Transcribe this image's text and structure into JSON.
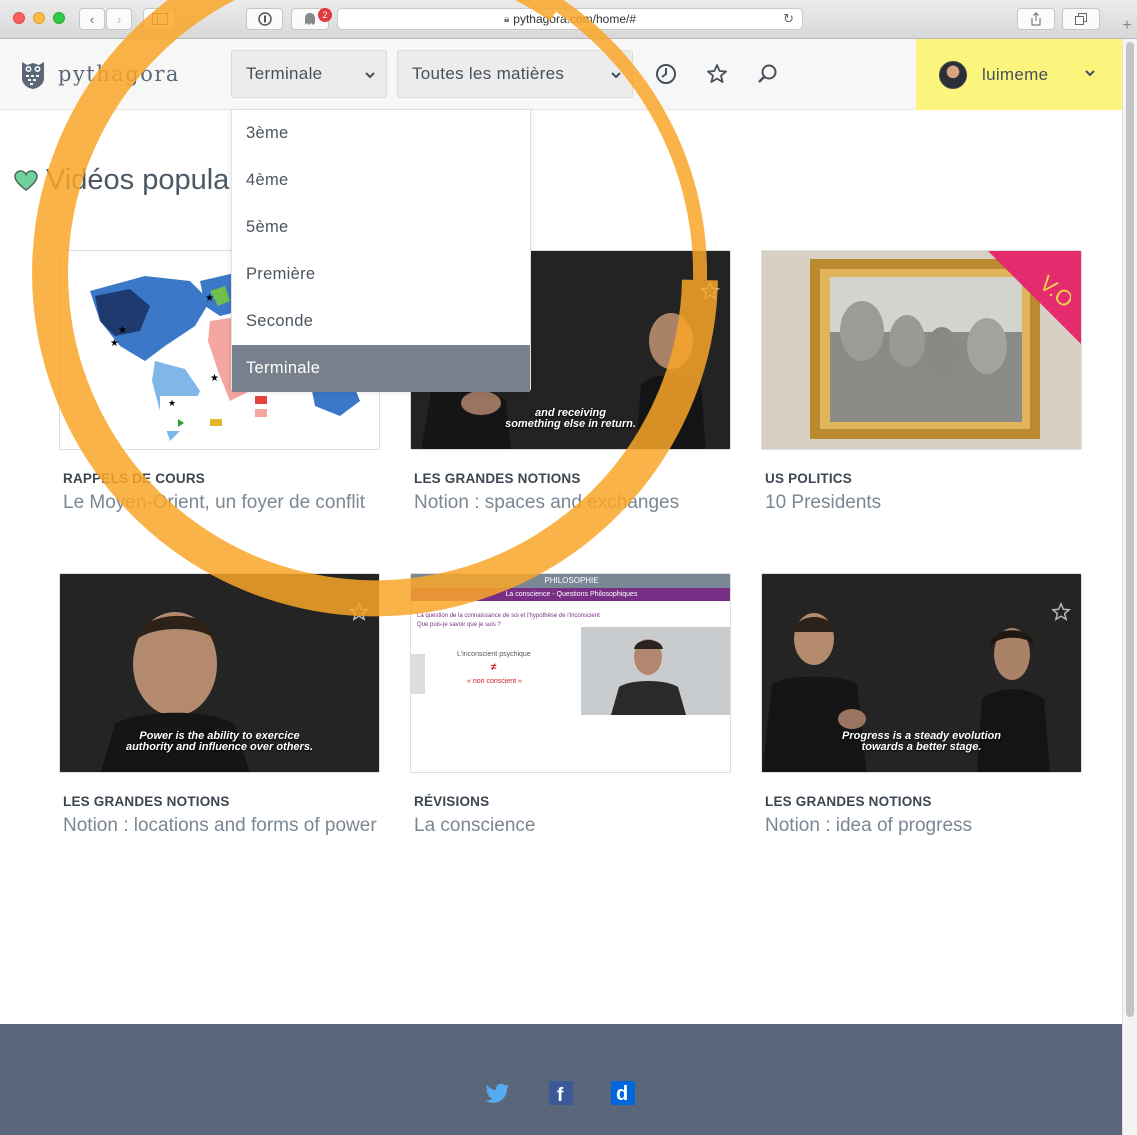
{
  "browser": {
    "url": "pythagora.com/home/#",
    "notification_count": "2"
  },
  "header": {
    "logo_text": "pythagora",
    "level_select": "Terminale",
    "subject_select": "Toutes les matières",
    "icons": [
      "history-icon",
      "star-icon",
      "search-icon"
    ],
    "username": "luimeme",
    "user_area_color": "#fbf57d"
  },
  "dropdown": {
    "items": [
      {
        "label": "3ème",
        "selected": false
      },
      {
        "label": "4ème",
        "selected": false
      },
      {
        "label": "5ème",
        "selected": false
      },
      {
        "label": "Première",
        "selected": false
      },
      {
        "label": "Seconde",
        "selected": false
      },
      {
        "label": "Terminale",
        "selected": true
      }
    ]
  },
  "section": {
    "title": "Vidéos populaires"
  },
  "cards": [
    {
      "category": "RAPPELS DE COURS",
      "title": "Le Moyen-Orient, un foyer de conflit",
      "thumb": "world-map"
    },
    {
      "category": "LES GRANDES NOTIONS",
      "title": "Notion : spaces and exchanges",
      "thumb": "video",
      "subtitle": [
        "and receiving",
        "something else in return."
      ]
    },
    {
      "category": "US POLITICS",
      "title": "10 Presidents",
      "thumb": "mount-rushmore",
      "ribbon": "V.O"
    },
    {
      "category": "LES GRANDES NOTIONS",
      "title": "Notion : locations and forms of power",
      "thumb": "video",
      "subtitle": [
        "Power is the ability to exercice",
        "authority and influence over others."
      ]
    },
    {
      "category": "RÉVISIONS",
      "title": "La conscience",
      "thumb": "slide",
      "slide_header": "PHILOSOPHIE",
      "slide_sub": "La conscience - Questions Philosophiques",
      "slide_line": "La question de la connaissance de soi et l'hypothèse de l'inconscient",
      "slide_q": "Que puis-je savoir que je suis ?",
      "slide_a": "L'inconscient psychique",
      "slide_neq": "≠",
      "slide_b": "« non conscient »"
    },
    {
      "category": "LES GRANDES NOTIONS",
      "title": "Notion : idea of progress",
      "thumb": "video",
      "subtitle": [
        "Progress is a steady evolution",
        "towards a better stage."
      ]
    }
  ],
  "footer": {
    "icons": [
      "twitter-icon",
      "facebook-icon",
      "dailymotion-icon"
    ],
    "dailymotion_letter": "d",
    "facebook_letter": "f"
  },
  "colors": {
    "annotation_ring": "#f9a628",
    "dropdown_selected": "#77808c",
    "footer": "#5a6679",
    "heart": "#6ed39b"
  }
}
